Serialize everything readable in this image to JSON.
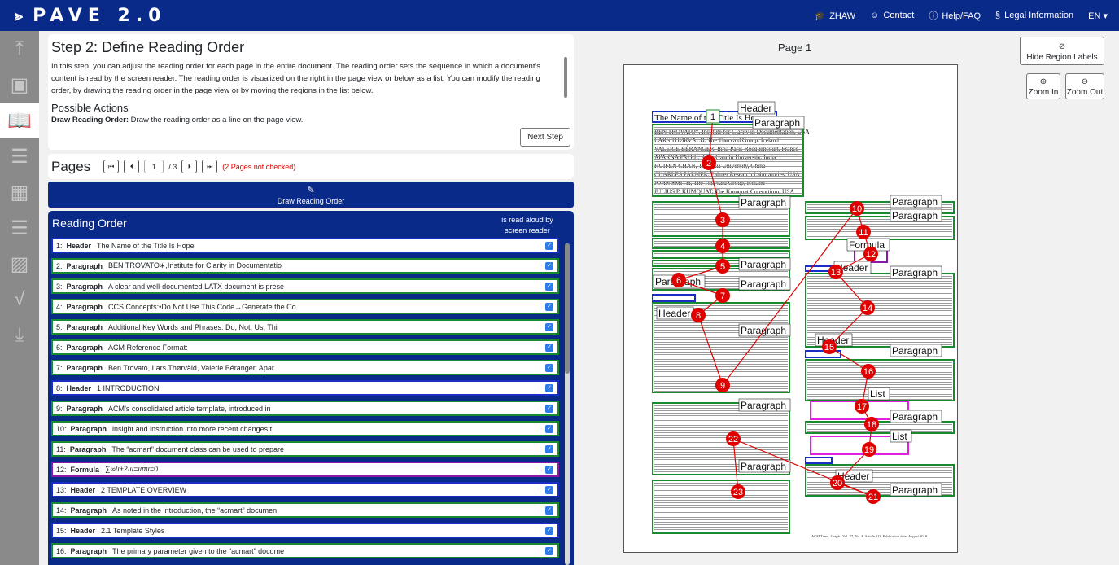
{
  "app": {
    "logo": "PAVE 2.0",
    "nav": [
      {
        "icon": "graduation-cap-icon",
        "label": "ZHAW"
      },
      {
        "icon": "user-icon",
        "label": "Contact"
      },
      {
        "icon": "help-icon",
        "label": "Help/FAQ"
      },
      {
        "icon": "section-icon",
        "label": "Legal Information"
      },
      {
        "icon": "",
        "label": "EN ▾"
      }
    ]
  },
  "step": {
    "title": "Step 2: Define Reading Order",
    "intro": "In this step, you can adjust the reading order for each page in the entire document. The reading order sets the sequence in which a document's content is read by the screen reader. The reading order is visualized on the right in the page view or below as a list. You can modify the reading order, by drawing the reading order in the page view or by moving the regions in the list below.",
    "actions_title": "Possible Actions",
    "action_label": "Draw Reading Order:",
    "action_text": " Draw the reading order as a line on the page view.",
    "next": "Next Step"
  },
  "pages": {
    "label": "Pages",
    "current": "1",
    "of": "/ 3",
    "warning": "(2 Pages not checked)"
  },
  "draw_button": "Draw Reading Order",
  "reading_order": {
    "title": "Reading Order",
    "aloud": "is read aloud by screen reader",
    "items": [
      {
        "n": "1:",
        "type": "Header",
        "text": "The Name of the Title Is Hope"
      },
      {
        "n": "2:",
        "type": "Paragraph",
        "text": "BEN TROVATO∗,Institute for Clarity in Documentatio"
      },
      {
        "n": "3:",
        "type": "Paragraph",
        "text": "A clear and well-documented LATX document is prese"
      },
      {
        "n": "4:",
        "type": "Paragraph",
        "text": "CCS Concepts:•Do Not Use This Code→Generate the Co"
      },
      {
        "n": "5:",
        "type": "Paragraph",
        "text": "Additional Key Words and Phrases: Do, Not, Us, Thi"
      },
      {
        "n": "6:",
        "type": "Paragraph",
        "text": "ACM Reference Format:"
      },
      {
        "n": "7:",
        "type": "Paragraph",
        "text": "Ben Trovato, Lars Thørväld, Valerie Béranger, Apar"
      },
      {
        "n": "8:",
        "type": "Header",
        "text": "1 INTRODUCTION"
      },
      {
        "n": "9:",
        "type": "Paragraph",
        "text": "ACM’s consolidated article template, introduced in"
      },
      {
        "n": "10:",
        "type": "Paragraph",
        "text": "insight and instruction into more recent changes t"
      },
      {
        "n": "11:",
        "type": "Paragraph",
        "text": "The “acmart” document class can be used to prepare"
      },
      {
        "n": "12:",
        "type": "Formula",
        "text": "∑∞/𝑖+2𝑖𝑖𝑖=𝑖𝑖𝑚𝑖=0"
      },
      {
        "n": "13:",
        "type": "Header",
        "text": "2 TEMPLATE OVERVIEW"
      },
      {
        "n": "14:",
        "type": "Paragraph",
        "text": "As noted in the introduction, the “acmart” documen"
      },
      {
        "n": "15:",
        "type": "Header",
        "text": "2.1 Template Styles"
      },
      {
        "n": "16:",
        "type": "Paragraph",
        "text": "The primary parameter given to the “acmart” docume"
      }
    ]
  },
  "page_view": {
    "title": "Page 1",
    "hide_labels": "Hide Region Labels",
    "zoom_in": "Zoom In",
    "zoom_out": "Zoom Out",
    "doc_title": "The Name of the Title Is Hope",
    "doc_authors": [
      "BEN TROVATO*, Institute for Clarity in Documentation, USA",
      "LARS THØRVÄLD, The Thørväld Group, Iceland",
      "VALERIE BÉRANGER, Inria Paris-Rocquencourt, France",
      "APARNA PATEL, Rajiv Gandhi University, India",
      "HUIFEN CHAN, Tsinghua University, China",
      "CHARLES PALMER, Palmer Research Laboratories, USA",
      "JOHN SMITH, The Thørväld Group, Iceland",
      "JULIUS P. KUMQUAT, The Kumquat Consortium, USA"
    ],
    "footer": "ACM Trans. Graph., Vol. 37, No. 4, Article 111. Publication date: August 2018.",
    "region_labels": {
      "header": "Header",
      "paragraph": "Paragraph",
      "formula": "Formula",
      "list": "List"
    },
    "colors": {
      "header": "#1a2ec5",
      "paragraph": "#1a8a2e",
      "formula": "#8a1aa5",
      "list": "#e020e0",
      "marker": "#e00000"
    }
  }
}
